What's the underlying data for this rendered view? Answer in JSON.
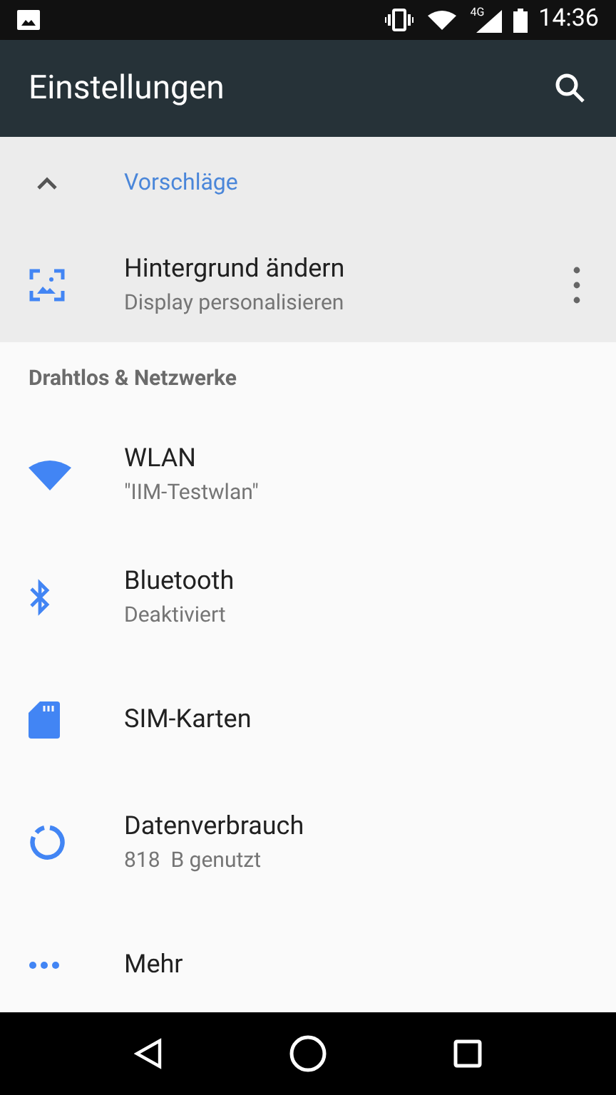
{
  "status_bar": {
    "time": "14:36",
    "network": "4G"
  },
  "toolbar": {
    "title": "Einstellungen"
  },
  "suggestions": {
    "title": "Vorschläge",
    "expanded": true,
    "items": [
      {
        "kind": "wallpaper",
        "title": "Hintergrund ändern",
        "subtitle": "Display personalisieren"
      }
    ]
  },
  "sections": [
    {
      "title": "Drahtlos & Netzwerke",
      "items": [
        {
          "kind": "wifi",
          "title": "WLAN",
          "subtitle": "\"IIM-Testwlan\""
        },
        {
          "kind": "bluetooth",
          "title": "Bluetooth",
          "subtitle": "Deaktiviert"
        },
        {
          "kind": "sim",
          "title": "SIM-Karten"
        },
        {
          "kind": "data",
          "title": "Datenverbrauch",
          "subtitle": "818  B genutzt"
        },
        {
          "kind": "more",
          "title": "Mehr"
        }
      ]
    }
  ]
}
